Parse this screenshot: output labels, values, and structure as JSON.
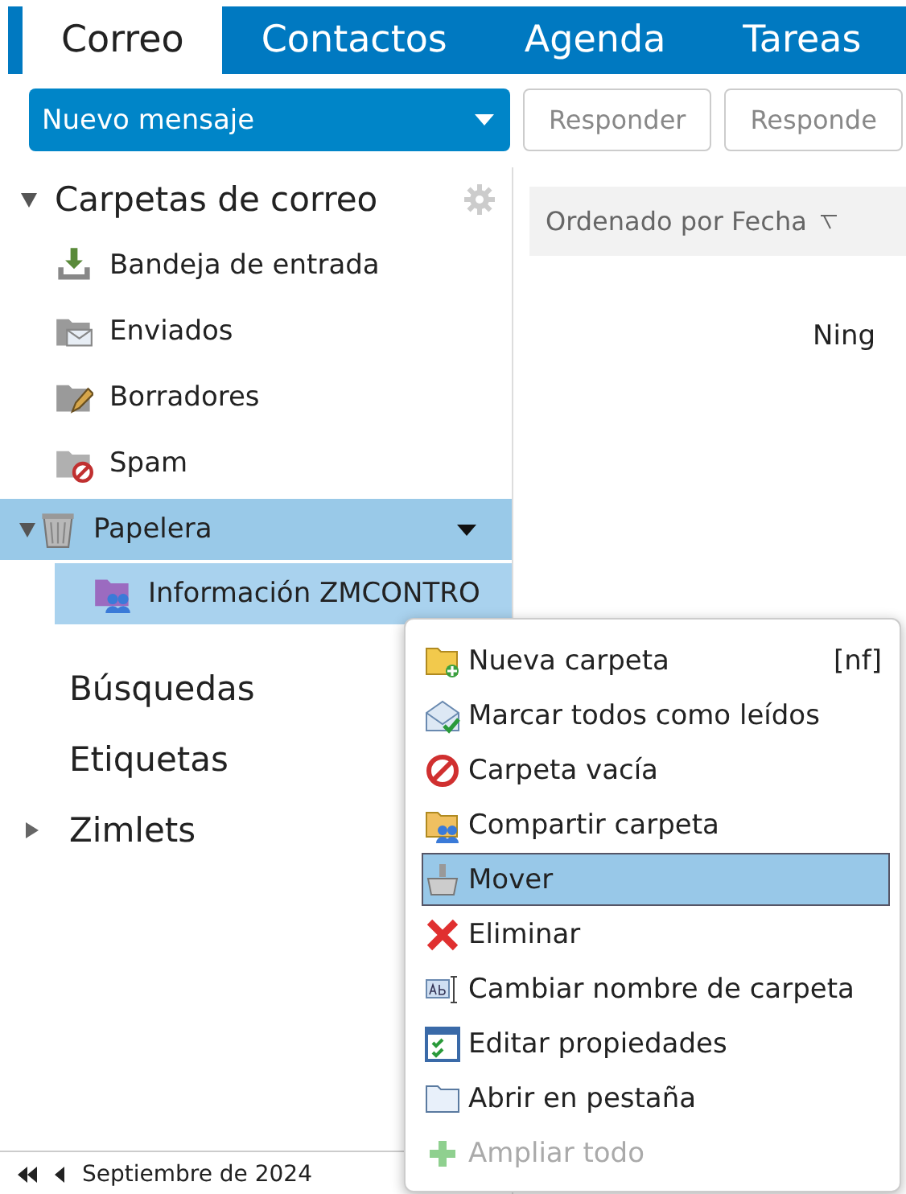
{
  "tabs": [
    {
      "label": "Correo",
      "selected": true
    },
    {
      "label": "Contactos",
      "selected": false
    },
    {
      "label": "Agenda",
      "selected": false
    },
    {
      "label": "Tareas",
      "selected": false
    }
  ],
  "toolbar": {
    "new_message": "Nuevo mensaje",
    "buttons": [
      "Responder",
      "Responde"
    ]
  },
  "sidebar": {
    "header": {
      "label": "Carpetas de correo",
      "expanded": true
    },
    "folders": [
      {
        "label": "Bandeja de entrada",
        "kind": "inbox",
        "selected": false
      },
      {
        "label": "Enviados",
        "kind": "sent",
        "selected": false
      },
      {
        "label": "Borradores",
        "kind": "drafts",
        "selected": false
      },
      {
        "label": "Spam",
        "kind": "spam",
        "selected": false
      },
      {
        "label": "Papelera",
        "kind": "trash",
        "selected": true,
        "expanded": true,
        "children": [
          {
            "label": "Información ZMCONTRO",
            "kind": "shared",
            "selected": true
          }
        ]
      }
    ],
    "sections": [
      {
        "label": "Búsquedas"
      },
      {
        "label": "Etiquetas"
      },
      {
        "label": "Zimlets",
        "expanded": false
      }
    ]
  },
  "calendar": {
    "month": "Septiembre de 2024"
  },
  "message_list": {
    "sort_label": "Ordenado por Fecha",
    "empty_text": "Ning"
  },
  "context_menu": [
    {
      "label": "Nueva carpeta",
      "kind": "new-folder",
      "shortcut": "[nf]",
      "selected": false,
      "disabled": false
    },
    {
      "label": "Marcar todos como leídos",
      "kind": "mark-read",
      "selected": false,
      "disabled": false
    },
    {
      "label": "Carpeta vacía",
      "kind": "empty",
      "selected": false,
      "disabled": false
    },
    {
      "label": "Compartir carpeta",
      "kind": "share",
      "selected": false,
      "disabled": false
    },
    {
      "label": "Mover",
      "kind": "move",
      "selected": true,
      "disabled": false
    },
    {
      "label": "Eliminar",
      "kind": "delete",
      "selected": false,
      "disabled": false
    },
    {
      "label": "Cambiar nombre de carpeta",
      "kind": "rename",
      "selected": false,
      "disabled": false
    },
    {
      "label": "Editar propiedades",
      "kind": "properties",
      "selected": false,
      "disabled": false
    },
    {
      "label": "Abrir en pestaña",
      "kind": "open-tab",
      "selected": false,
      "disabled": false
    },
    {
      "label": "Ampliar todo",
      "kind": "expand",
      "selected": false,
      "disabled": true
    }
  ]
}
